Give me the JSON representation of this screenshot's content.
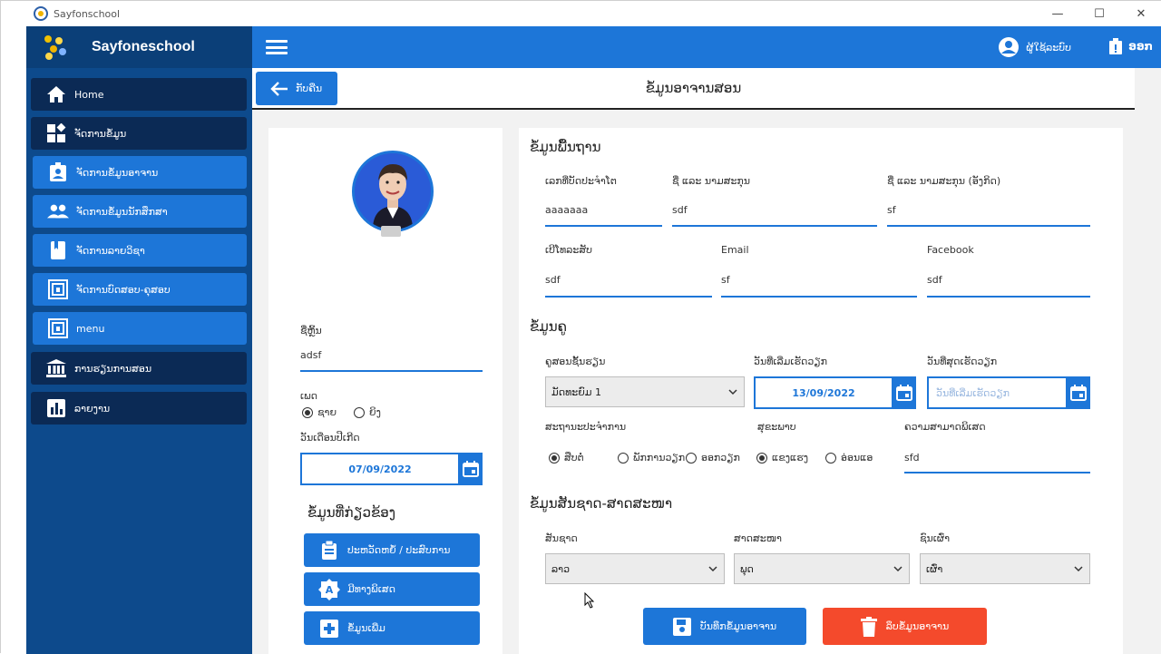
{
  "window": {
    "title": "Sayfonschool",
    "minimize": "—",
    "maximize": "☐",
    "close": "✕"
  },
  "brand": {
    "name": "Sayfoneschool"
  },
  "sidebar": {
    "items": [
      {
        "label": "Home",
        "icon": "home-icon"
      },
      {
        "label": "ຈັດການຂໍ້ມູນ",
        "icon": "dashboard-icon"
      },
      {
        "label": "ຈັດການຂໍ້ມູນອາຈານ",
        "icon": "teacher-badge-icon"
      },
      {
        "label": "ຈັດການຂໍ້ມູນນັກສຶກສາ",
        "icon": "students-icon"
      },
      {
        "label": "ຈັດການລາຍວິຊາ",
        "icon": "book-icon"
      },
      {
        "label": "ຈັດການບົດສອບ-ຄຸສອບ",
        "icon": "test-icon"
      },
      {
        "label": "menu",
        "icon": "menu-box-icon"
      },
      {
        "label": "ການຮຽນການສອນ",
        "icon": "bank-icon"
      },
      {
        "label": "ລາຍງານ",
        "icon": "chart-icon"
      }
    ]
  },
  "topbar": {
    "user_label": "ຜູ້ໃຊ້ລະບົບ",
    "logout_label": "ອອກ"
  },
  "header": {
    "back_label": "ກັບຄືນ",
    "title": "ຂໍ້ມູນອາຈານສອນ"
  },
  "left": {
    "nickname_label": "ຊື່ຫຼິ້ນ",
    "nickname_value": "adsf",
    "gender_label": "ເພດ",
    "gender_options": [
      "ຊາຍ",
      "ຍິງ"
    ],
    "gender_selected": "ຊາຍ",
    "dob_label": "ວັນເດືອນປີເກີດ",
    "dob_value": "07/09/2022",
    "related_title": "ຂໍ້ມູນທີ່ກ່ຽວຂ້ອງ",
    "buttons": [
      {
        "label": "ປະຫວັດຫຍໍ້ / ປະສົບການ",
        "icon": "clipboard-icon"
      },
      {
        "label": "ມີທາງພິເສດ",
        "icon": "skill-badge-icon"
      },
      {
        "label": "ຂໍ້ມູນເພີ່ມ",
        "icon": "plus-box-icon"
      }
    ]
  },
  "basic": {
    "title": "ຂໍ້ມູນພື້ນຖານ",
    "fields": [
      {
        "label": "ເລກທີ່ບັດປະຈຳໂຕ",
        "value": "aaaaaaa"
      },
      {
        "label": "ຊື່ ແລະ ນາມສະກຸນ",
        "value": "sdf"
      },
      {
        "label": "ຊື່ ແລະ ນາມສະກຸນ (ອັງກິດ)",
        "value": "sf"
      },
      {
        "label": "ເບີໂທລະສັບ",
        "value": "sdf"
      },
      {
        "label": "Email",
        "value": "sf"
      },
      {
        "label": "Facebook",
        "value": "sdf"
      }
    ]
  },
  "teacher": {
    "title": "ຂໍ້ມູນຄູ",
    "level_label": "ຄູສອນຊັ້ນຮຽນ",
    "level_value": "ມັດທະຍົມ 1",
    "start_label": "ວັນທີ່ເລີ່ມເຮັດວຽກ",
    "start_value": "13/09/2022",
    "end_label": "ວັນທີ່ສຸດເຮັດວຽກ",
    "end_placeholder": "ວັນທີ່ເລີ່ມເຮັດວຽກ",
    "status_label": "ສະຖານະປະຈຳການ",
    "status_options": [
      "ສືບຕໍ່",
      "ພັກການວຽກ",
      "ອອກວຽກ"
    ],
    "status_selected": "ສືບຕໍ່",
    "marital_label": "ສຸຂະພາບ",
    "marital_options": [
      "ແຂງແຮງ",
      "ອ່ອນແອ"
    ],
    "marital_selected": "ແຂງແຮງ",
    "ability_label": "ຄວາມສາມາດພິເສດ",
    "ability_value": "sfd"
  },
  "nation": {
    "title": "ຂໍ້ມູນສັນຊາດ-ສາດສະໜາ",
    "nationality_label": "ສັນຊາດ",
    "nationality_value": "ລາວ",
    "religion_label": "ສາດສະໜາ",
    "religion_value": "ພຸດ",
    "ethnic_label": "ຊົນເຜົ່າ",
    "ethnic_value": "ເຜົ່າ"
  },
  "actions": {
    "save_label": "ບັນທຶກຂໍ້ມູນອາຈານ",
    "delete_label": "ລຶບຂໍ້ມູນອາຈານ"
  },
  "colors": {
    "primary": "#1d76d8",
    "sidebar": "#0d4a8c",
    "sidebar_dark": "#0b2a55",
    "danger": "#f44a2c"
  }
}
